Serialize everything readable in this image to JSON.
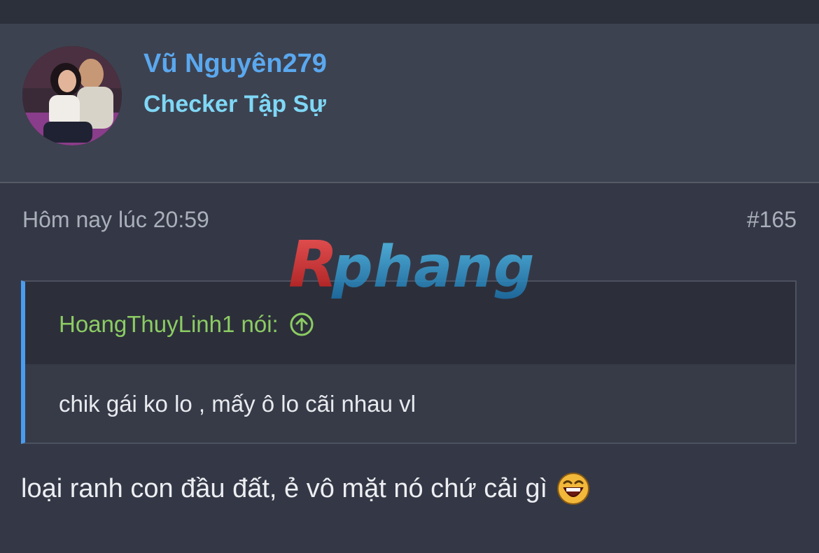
{
  "post": {
    "username": "Vũ Nguyên279",
    "user_title": "Checker Tập Sự",
    "timestamp": "Hôm nay lúc 20:59",
    "post_number": "#165",
    "quote": {
      "author_label": "HoangThuyLinh1 nói:",
      "text": "chik gái ko lo , mấy ô lo cãi nhau vl"
    },
    "message": "loại ranh con đầu đất, ẻ vô mặt nó chứ cải gì",
    "emoji_icon": "laughing-face-icon"
  },
  "watermark": {
    "text": "Rphang"
  },
  "colors": {
    "username": "#5aa8ef",
    "user_title": "#7fd7f5",
    "quote_author": "#8ccc63",
    "quote_border": "#4a9cf0"
  }
}
